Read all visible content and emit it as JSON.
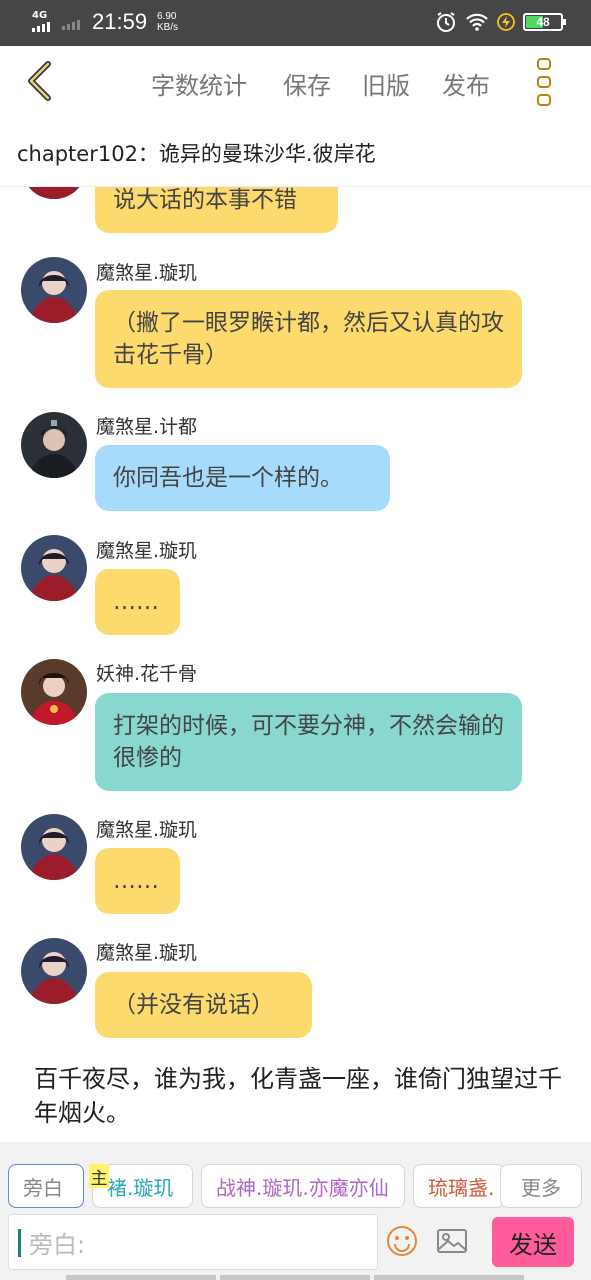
{
  "status_bar": {
    "network": "4G",
    "time": "21:59",
    "speed_value": "6.90",
    "speed_unit": "KB/s",
    "battery": "48"
  },
  "toolbar": {
    "actions": [
      "字数统计",
      "保存",
      "旧版",
      "发布"
    ]
  },
  "chapter": {
    "title": "chapter102：诡异的曼珠沙华.彼岸花"
  },
  "messages": [
    {
      "name": "",
      "text": "说大话的本事不错",
      "color": "#fdda6e"
    },
    {
      "name": "魔煞星.璇玑",
      "text": "（撇了一眼罗睺计都，然后又认真的攻击花千骨）",
      "color": "#fdda6e"
    },
    {
      "name": "魔煞星.计都",
      "text": "你同吾也是一个样的。",
      "color": "#a6dbfc"
    },
    {
      "name": "魔煞星.璇玑",
      "text": "……",
      "color": "#fdda6e"
    },
    {
      "name": "妖神.花千骨",
      "text": "打架的时候，可不要分神，不然会输的很惨的",
      "color": "#88d8cf"
    },
    {
      "name": "魔煞星.璇玑",
      "text": "……",
      "color": "#fdda6e"
    },
    {
      "name": "魔煞星.璇玑",
      "text": "（并没有说话）",
      "color": "#fdda6e"
    }
  ],
  "narration": "百千夜尽，谁为我，化青盏一座，谁倚门独望过千年烟火。",
  "roles": {
    "items": [
      {
        "label": "旁白",
        "color": "#888888"
      },
      {
        "label": "褚.璇玑",
        "color": "#2aa7b8"
      },
      {
        "label": "战神.璇玑.亦魔亦仙",
        "color": "#b266c6"
      },
      {
        "label": "琉璃盏.",
        "color": "#d05a3a"
      }
    ],
    "host_badge": "主",
    "more": "更多"
  },
  "composer": {
    "placeholder": "旁白:",
    "send": "发送"
  }
}
